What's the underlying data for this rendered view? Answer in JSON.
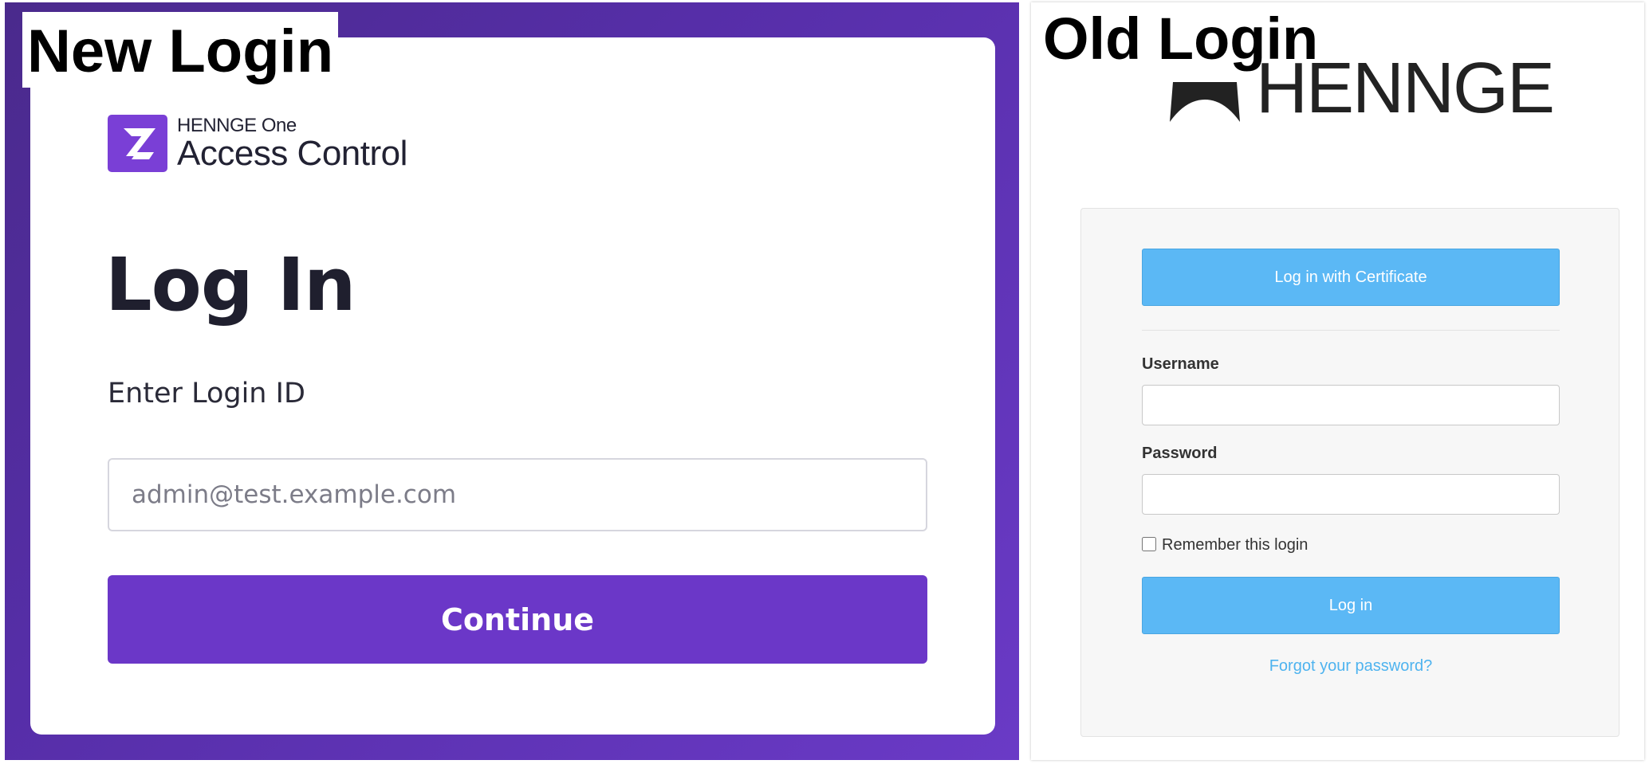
{
  "new_login": {
    "caption": "New Login",
    "logo": {
      "icon": "henge-one-logo-icon",
      "brand_small": "HENNGE One",
      "product_name": "Access Control",
      "color": "#7a3fd6"
    },
    "heading": "Log In",
    "subtitle": "Enter Login ID",
    "login_id_input": {
      "placeholder": "admin@test.example.com",
      "value": ""
    },
    "continue_label": "Continue",
    "colors": {
      "background": "#562ea8",
      "button": "#6b37c8"
    }
  },
  "old_login": {
    "caption": "Old Login",
    "logo": {
      "icon": "henne-logo-icon",
      "wordmark": "HENNGE"
    },
    "cert_button_label": "Log in with Certificate",
    "username_label": "Username",
    "username_value": "",
    "password_label": "Password",
    "password_value": "",
    "remember_label": "Remember this login",
    "remember_checked": false,
    "login_button_label": "Log in",
    "forgot_link_label": "Forgot your password?",
    "colors": {
      "button": "#5bb8f5",
      "link": "#4eb3ef"
    }
  }
}
